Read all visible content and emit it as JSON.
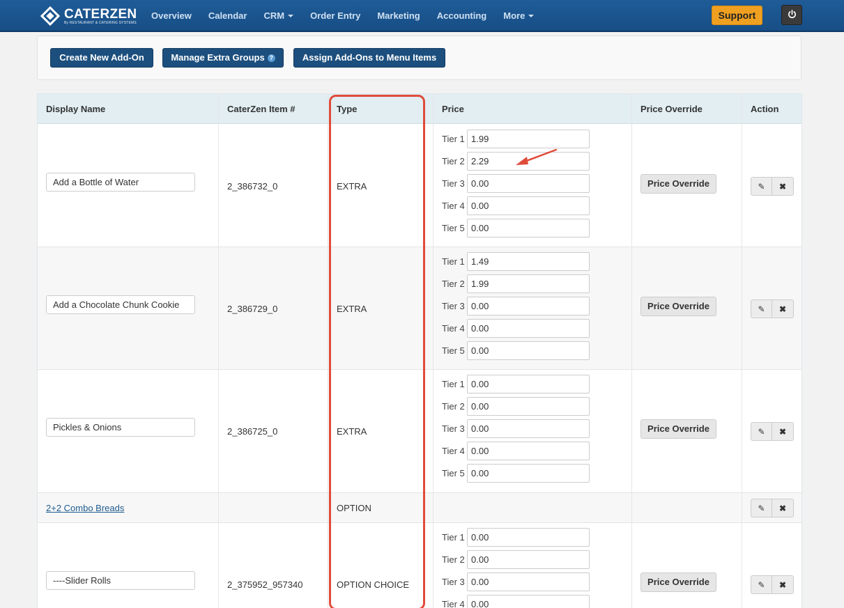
{
  "nav": {
    "logo": {
      "name": "CATERZEN",
      "tagline": "By RESTAURANT & CATERING SYSTEMS"
    },
    "items": [
      {
        "label": "Overview",
        "dropdown": false
      },
      {
        "label": "Calendar",
        "dropdown": false
      },
      {
        "label": "CRM",
        "dropdown": true
      },
      {
        "label": "Order Entry",
        "dropdown": false
      },
      {
        "label": "Marketing",
        "dropdown": false
      },
      {
        "label": "Accounting",
        "dropdown": false
      },
      {
        "label": "More",
        "dropdown": true
      }
    ],
    "support_label": "Support",
    "power_icon": "power-icon"
  },
  "actions": {
    "create_label": "Create New Add-On",
    "manage_label": "Manage Extra Groups",
    "manage_help": "?",
    "assign_label": "Assign Add-Ons to Menu Items"
  },
  "table": {
    "headers": {
      "display_name": "Display Name",
      "item_no": "CaterZen Item #",
      "type": "Type",
      "price": "Price",
      "price_override": "Price Override",
      "action": "Action"
    },
    "tier_labels": [
      "Tier 1",
      "Tier 2",
      "Tier 3",
      "Tier 4",
      "Tier 5"
    ],
    "price_override_label": "Price Override",
    "rows": [
      {
        "name": "Add a Bottle of Water",
        "item_no": "2_386732_0",
        "type": "EXTRA",
        "tiers": [
          "1.99",
          "2.29",
          "0.00",
          "0.00",
          "0.00"
        ]
      },
      {
        "name": "Add a Chocolate Chunk Cookie",
        "item_no": "2_386729_0",
        "type": "EXTRA",
        "tiers": [
          "1.49",
          "1.99",
          "0.00",
          "0.00",
          "0.00"
        ]
      },
      {
        "name": "Pickles & Onions",
        "item_no": "2_386725_0",
        "type": "EXTRA",
        "tiers": [
          "0.00",
          "0.00",
          "0.00",
          "0.00",
          "0.00"
        ]
      },
      {
        "name": "2+2 Combo Breads",
        "item_no": "",
        "type": "OPTION",
        "tiers": []
      },
      {
        "name": "----Slider Rolls",
        "item_no": "2_375952_957340",
        "type": "OPTION CHOICE",
        "tiers": [
          "0.00",
          "0.00",
          "0.00",
          "0.00"
        ]
      }
    ]
  },
  "annotation": {
    "color": "#e04b3a"
  }
}
